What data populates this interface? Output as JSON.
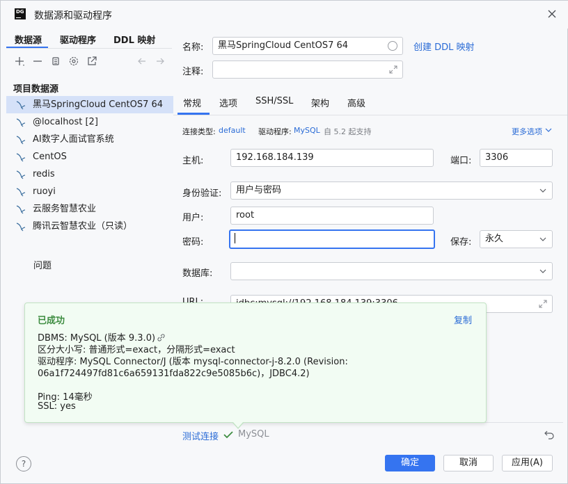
{
  "window": {
    "title": "数据源和驱动程序",
    "logo_text": "DG"
  },
  "left": {
    "tabs": [
      "数据源",
      "驱动程序",
      "DDL 映射"
    ],
    "section_title": "项目数据源",
    "datasources": [
      "黑马SpringCloud CentOS7 64",
      "@localhost [2]",
      "AI数字人面试官系统",
      "CentOS",
      "redis",
      "ruoyi",
      "云服务智慧农业",
      "腾讯云智慧农业（只读）"
    ],
    "problems_label": "问题"
  },
  "form": {
    "name_label": "名称:",
    "name_value": "黑马SpringCloud CentOS7 64",
    "create_ddl_link": "创建 DDL 映射",
    "comment_label": "注释:",
    "comment_value": "",
    "tabs": [
      "常规",
      "选项",
      "SSH/SSL",
      "架构",
      "高级"
    ],
    "conn_type_label": "连接类型:",
    "conn_type_value": "default",
    "driver_label": "驱动程序:",
    "driver_value": "MySQL",
    "driver_since": "自 5.2 起支持",
    "more_options": "更多选项",
    "host_label": "主机:",
    "host_value": "192.168.184.139",
    "port_label": "端口:",
    "port_value": "3306",
    "auth_label": "身份验证:",
    "auth_value": "用户与密码",
    "user_label": "用户:",
    "user_value": "root",
    "password_label": "密码:",
    "password_value": "",
    "save_label": "保存:",
    "save_value": "永久",
    "database_label": "数据库:",
    "database_value": "",
    "url_label": "URL:",
    "url_value": "jdbc:mysql://192.168.184.139:3306"
  },
  "popup": {
    "title": "已成功",
    "copy": "复制",
    "lines": [
      "DBMS: MySQL (版本 9.3.0)",
      "区分大小写: 普通形式=exact，分隔形式=exact",
      "驱动程序: MySQL Connector/J (版本 mysql-connector-j-8.2.0 (Revision:",
      "06a1f724497fd81c6a659131fda822c9e5085b6c)，JDBC4.2)",
      "Ping: 14毫秒",
      "SSL: yes"
    ]
  },
  "bottom": {
    "test_connection": "测试连接",
    "test_result": "MySQL",
    "help": "?",
    "ok": "确定",
    "cancel": "取消",
    "apply": "应用(A)"
  },
  "colors": {
    "accent": "#3574f0",
    "success": "#3d8c40",
    "selected_row": "#d5e1f8"
  }
}
